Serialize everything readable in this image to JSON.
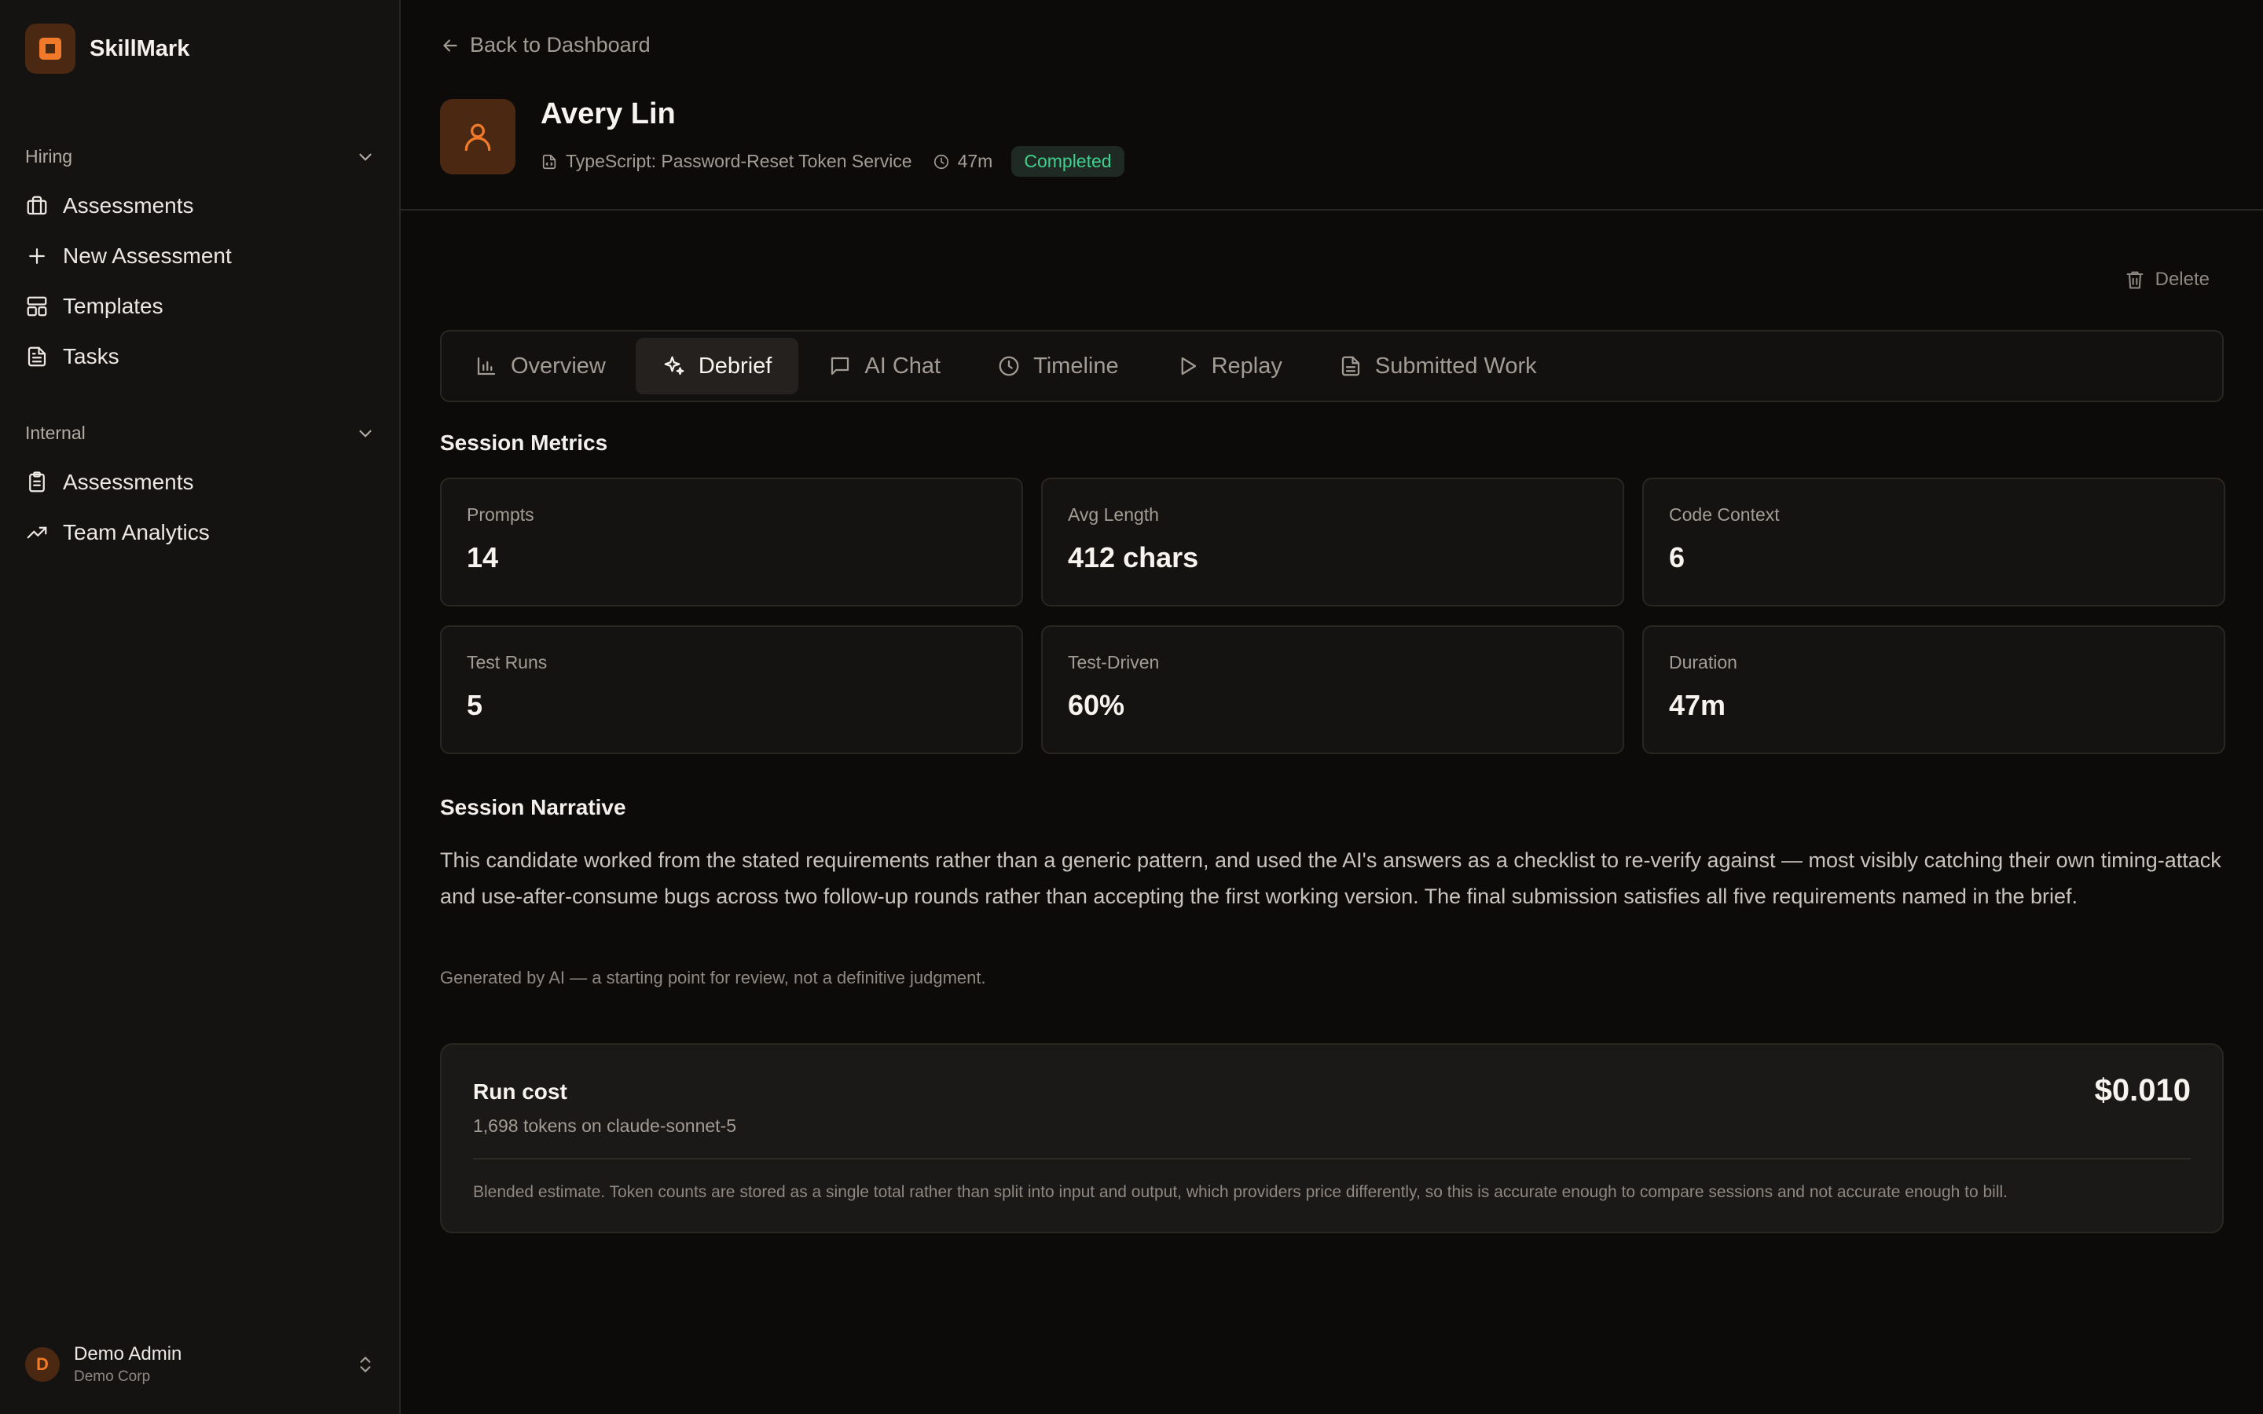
{
  "brand": {
    "name": "SkillMark",
    "accent": "#f07a2a"
  },
  "sidebar": {
    "groups": [
      {
        "title": "Hiring",
        "items": [
          {
            "label": "Assessments",
            "icon": "briefcase-icon"
          },
          {
            "label": "New Assessment",
            "icon": "plus-icon"
          },
          {
            "label": "Templates",
            "icon": "layout-icon"
          },
          {
            "label": "Tasks",
            "icon": "file-text-icon"
          }
        ]
      },
      {
        "title": "Internal",
        "items": [
          {
            "label": "Assessments",
            "icon": "clipboard-icon"
          },
          {
            "label": "Team Analytics",
            "icon": "trending-up-icon"
          }
        ]
      }
    ],
    "user": {
      "initial": "D",
      "name": "Demo Admin",
      "org": "Demo Corp"
    }
  },
  "header": {
    "back_label": "Back to Dashboard",
    "candidate_name": "Avery Lin",
    "task": "TypeScript: Password-Reset Token Service",
    "duration": "47m",
    "status": "Completed",
    "status_color": "#3fd08c"
  },
  "actions": {
    "delete_label": "Delete"
  },
  "tabs": [
    {
      "label": "Overview",
      "icon": "bar-chart-icon",
      "active": false
    },
    {
      "label": "Debrief",
      "icon": "sparkles-icon",
      "active": true
    },
    {
      "label": "AI Chat",
      "icon": "message-icon",
      "active": false
    },
    {
      "label": "Timeline",
      "icon": "clock-icon",
      "active": false
    },
    {
      "label": "Replay",
      "icon": "play-icon",
      "active": false
    },
    {
      "label": "Submitted Work",
      "icon": "file-icon",
      "active": false
    }
  ],
  "metrics": {
    "title": "Session Metrics",
    "items": [
      {
        "label": "Prompts",
        "value": "14"
      },
      {
        "label": "Avg Length",
        "value": "412 chars"
      },
      {
        "label": "Code Context",
        "value": "6"
      },
      {
        "label": "Test Runs",
        "value": "5"
      },
      {
        "label": "Test-Driven",
        "value": "60%"
      },
      {
        "label": "Duration",
        "value": "47m"
      }
    ]
  },
  "narrative": {
    "title": "Session Narrative",
    "text": "This candidate worked from the stated requirements rather than a generic pattern, and used the AI's answers as a checklist to re-verify against — most visibly catching their own timing-attack and use-after-consume bugs across two follow-up rounds rather than accepting the first working version. The final submission satisfies all five requirements named in the brief.",
    "note": "Generated by AI — a starting point for review, not a definitive judgment."
  },
  "cost": {
    "title": "Run cost",
    "subtitle": "1,698 tokens on claude-sonnet-5",
    "value": "$0.010",
    "note": "Blended estimate. Token counts are stored as a single total rather than split into input and output, which providers price differently, so this is accurate enough to compare sessions and not accurate enough to bill."
  }
}
